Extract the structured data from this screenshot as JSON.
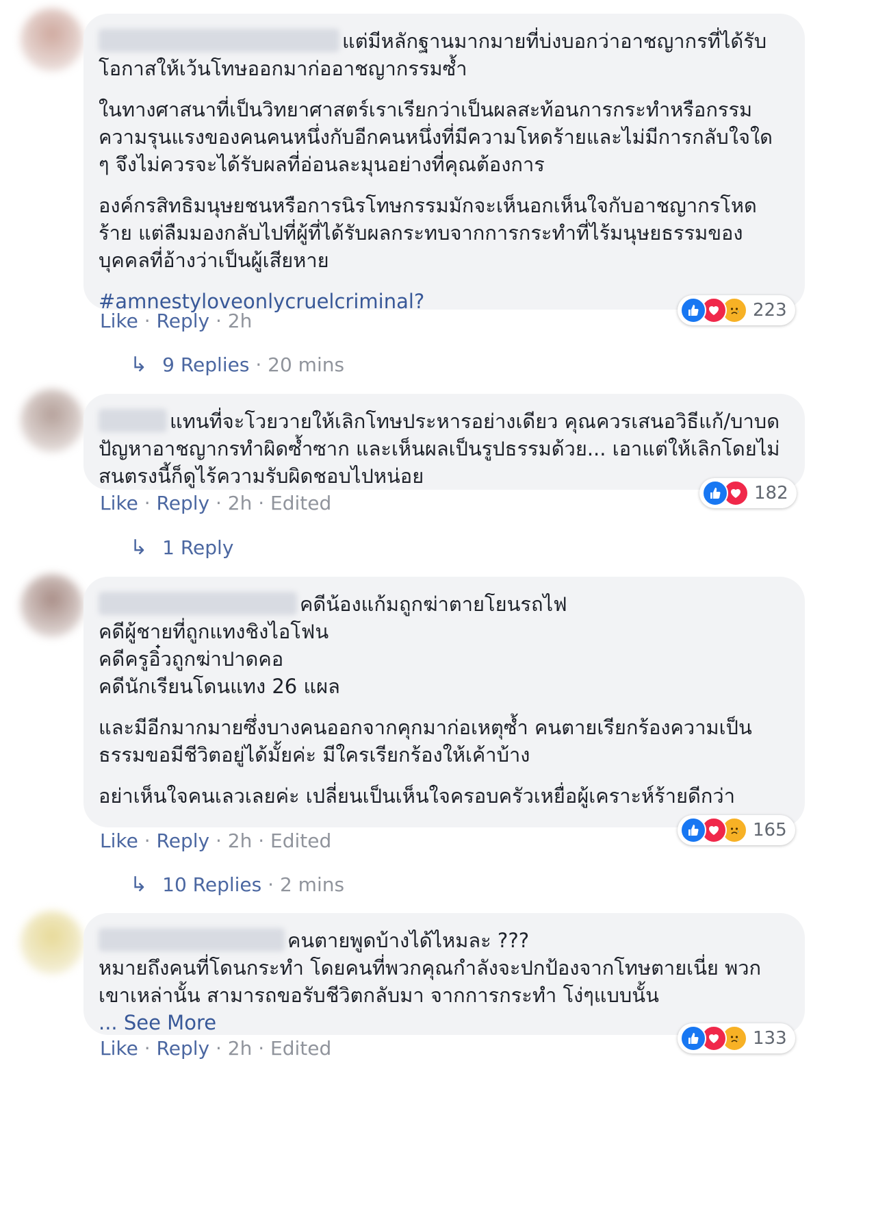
{
  "comments": [
    {
      "paragraphs": [
        "แต่มีหลักฐานมากมายที่บ่งบอกว่าอาชญากรที่ได้รับโอกาสให้เว้นโทษออกมาก่ออาชญากรรมซ้ำ",
        "ในทางศาสนาที่เป็นวิทยาศาสตร์เราเรียกว่าเป็นผลสะท้อนการกระทำหรือกรรม ความรุนแรงของคนคนหนึ่งกับอีกคนหนึ่งที่มีความโหดร้ายและไม่มีการกลับใจใด ๆ จึงไม่ควรจะได้รับผลที่อ่อนละมุนอย่างที่คุณต้องการ",
        "องค์กรสิทธิมนุษยชนหรือการนิรโทษกรรมมักจะเห็นอกเห็นใจกับอาชญากรโหดร้าย แต่ลืมมองกลับไปที่ผู้ที่ได้รับผลกระทบจากการกระทำที่ไร้มนุษยธรรมของบุคคลที่อ้างว่าเป็นผู้เสียหาย"
      ],
      "hashtag": "#amnestyloveonlycruelcriminal?",
      "reaction_count": "223",
      "like": "Like",
      "reply": "Reply",
      "time": "2h",
      "edited": "",
      "replies_label": "9 Replies",
      "replies_time": "20 mins"
    },
    {
      "paragraphs": [
        "แทนที่จะโวยวายให้เลิกโทษประหารอย่างเดียว คุณควรเสนอวิธีแก้/บาบดปัญหาอาชญากรทำผิดซ้ำซาก และเห็นผลเป็นรูปธรรมด้วย... เอาแต่ให้เลิกโดยไม่สนตรงนี้ก็ดูไร้ความรับผิดชอบไปหน่อย"
      ],
      "reaction_count": "182",
      "like": "Like",
      "reply": "Reply",
      "time": "2h",
      "edited": "Edited",
      "replies_label": "1 Reply",
      "replies_time": ""
    },
    {
      "paragraphs": [
        "คดีน้องแก้มถูกฆ่าตายโยนรถไฟ\nคดีผู้ชายที่ถูกแทงชิงไอโฟน\nคดีครูอิ๋วถูกฆ่าปาดคอ\nคดีนักเรียนโดนแทง 26 แผล",
        "และมีอีกมากมายซึ่งบางคนออกจากคุกมาก่อเหตุซ้ำ คนตายเรียกร้องความเป็นธรรมขอมีชีวิตอยู่ได้มั้ยค่ะ มีใครเรียกร้องให้เค้าบ้าง",
        "อย่าเห็นใจคนเลวเลยค่ะ เปลี่ยนเป็นเห็นใจครอบครัวเหยื่อผู้เคราะห์ร้ายดีกว่า"
      ],
      "reaction_count": "165",
      "like": "Like",
      "reply": "Reply",
      "time": "2h",
      "edited": "Edited",
      "replies_label": "10 Replies",
      "replies_time": "2 mins"
    },
    {
      "paragraphs": [
        "คนตายพูดบ้างได้ไหมละ ???\nหมายถึงคนที่โดนกระทำ โดยคนที่พวกคุณกำลังจะปกป้องจากโทษตายเนี่ย พวกเขาเหล่านั้น สามารถขอรับชีวิตกลับมา จากการกระทำ โง่ๆแบบนั้น"
      ],
      "see_more": "... See More",
      "reaction_count": "133",
      "like": "Like",
      "reply": "Reply",
      "time": "2h",
      "edited": "Edited"
    }
  ],
  "icons": {
    "like": "thumbs-up-icon",
    "love": "heart-icon",
    "sad": "sad-face-icon",
    "reply_arrow": "reply-arrow-icon"
  },
  "colors": {
    "bubble": "#f2f3f5",
    "link": "#4b67a1",
    "meta": "#90949c",
    "like": "#1877f2",
    "love": "#f0284a",
    "sad": "#f7b125"
  }
}
